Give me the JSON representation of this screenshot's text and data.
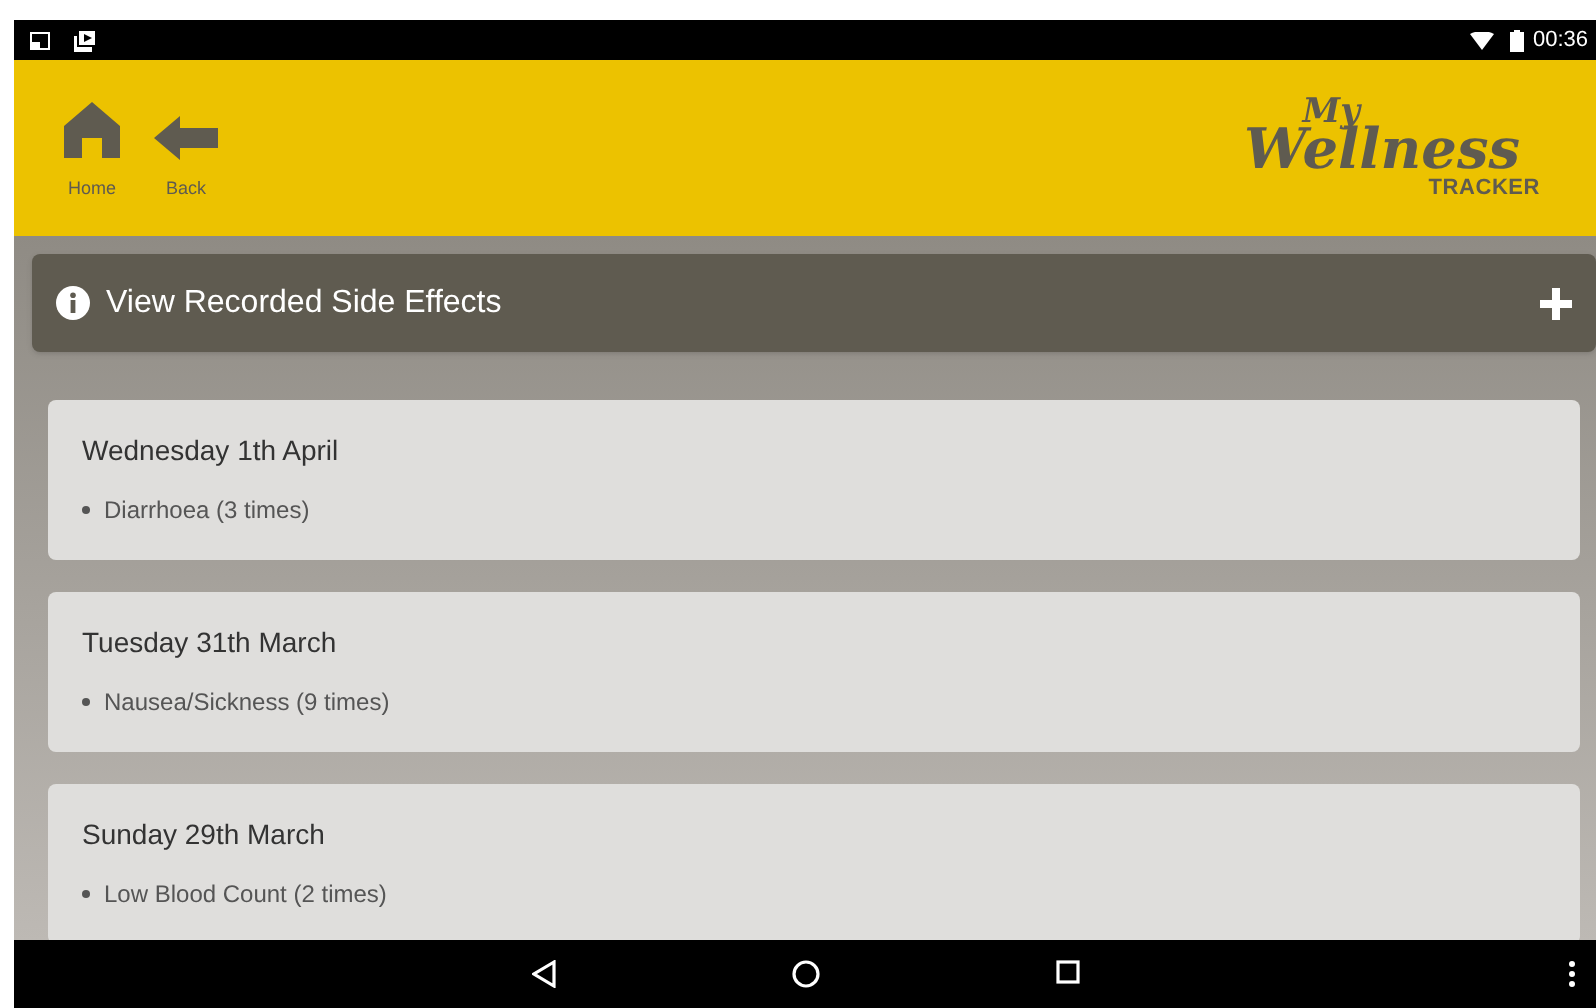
{
  "status_bar": {
    "time": "00:36"
  },
  "header": {
    "nav": [
      {
        "kind": "home",
        "label": "Home"
      },
      {
        "kind": "back",
        "label": "Back"
      }
    ],
    "logo": {
      "line1": "My",
      "line2": "Wellness",
      "line3": "TRACKER"
    }
  },
  "section": {
    "title": "View Recorded Side Effects"
  },
  "entries": [
    {
      "date": "Wednesday 1th April",
      "items": [
        "Diarrhoea (3 times)"
      ]
    },
    {
      "date": "Tuesday 31th March",
      "items": [
        "Nausea/Sickness (9 times)"
      ]
    },
    {
      "date": "Sunday 29th March",
      "items": [
        "Low Blood Count (2 times)"
      ]
    }
  ]
}
